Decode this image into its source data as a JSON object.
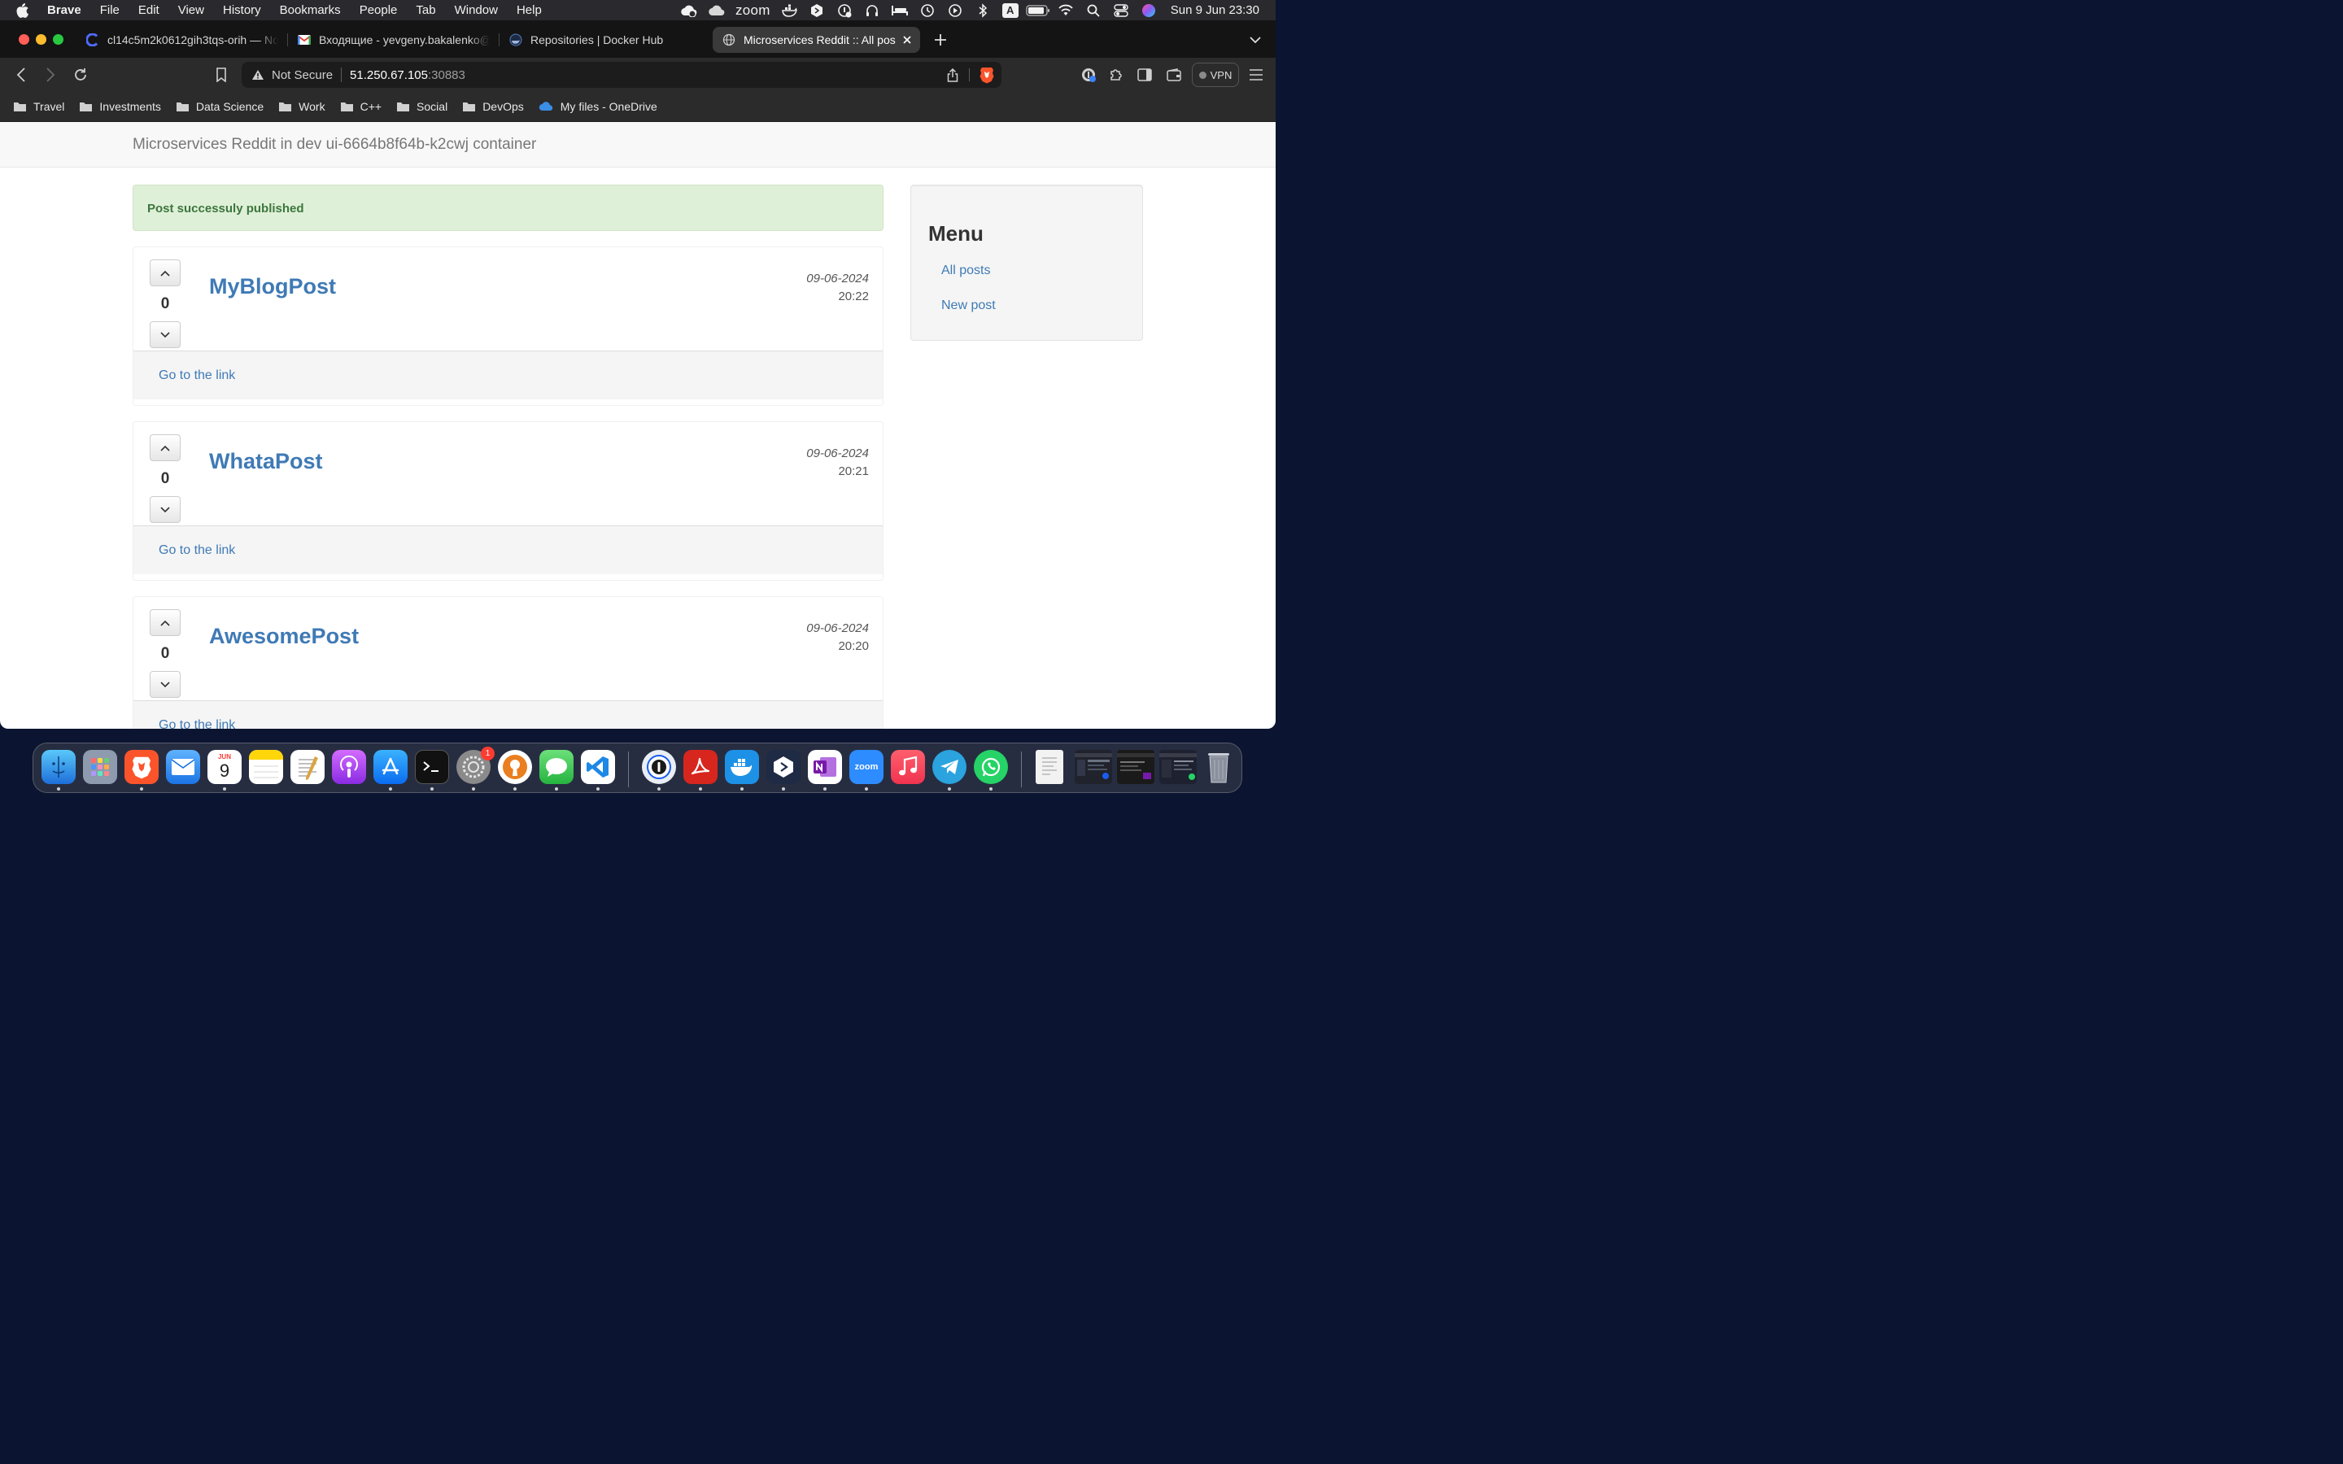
{
  "menubar": {
    "app": "Brave",
    "items": [
      "File",
      "Edit",
      "View",
      "History",
      "Bookmarks",
      "People",
      "Tab",
      "Window",
      "Help"
    ],
    "zoom": "zoom",
    "keyboard": "A",
    "clock": "Sun 9 Jun  23:30"
  },
  "tabs": [
    {
      "label": "cl14c5m2k0612gih3tqs-orih — No"
    },
    {
      "label": "Входящие - yevgeny.bakalenko@g"
    },
    {
      "label": "Repositories | Docker Hub"
    },
    {
      "label": "Microservices Reddit :: All pos"
    }
  ],
  "address": {
    "security": "Not Secure",
    "host": "51.250.67.105",
    "port": ":30883"
  },
  "vpn_label": "VPN",
  "bookmarks": [
    "Travel",
    "Investments",
    "Data Science",
    "Work",
    "C++",
    "Social",
    "DevOps",
    "My files - OneDrive"
  ],
  "page": {
    "brand": "Microservices Reddit in dev ui-6664b8f64b-k2cwj container",
    "alert": "Post successuly published",
    "posts": [
      {
        "title": "MyBlogPost",
        "votes": "0",
        "date": "09-06-2024",
        "time": "20:22",
        "link": "Go to the link"
      },
      {
        "title": "WhataPost",
        "votes": "0",
        "date": "09-06-2024",
        "time": "20:21",
        "link": "Go to the link"
      },
      {
        "title": "AwesomePost",
        "votes": "0",
        "date": "09-06-2024",
        "time": "20:20",
        "link": "Go to the link"
      }
    ],
    "sidebar": {
      "title": "Menu",
      "links": [
        "All posts",
        "New post"
      ]
    }
  },
  "dock": {
    "calendar_month": "JUN",
    "calendar_day": "9",
    "settings_badge": "1",
    "zoom_label": "zoom"
  },
  "colors": {
    "link": "#3f7ab5",
    "alert_bg": "#dff0d8",
    "alert_text": "#3c763d",
    "active_tab": "#3a3a3a"
  }
}
